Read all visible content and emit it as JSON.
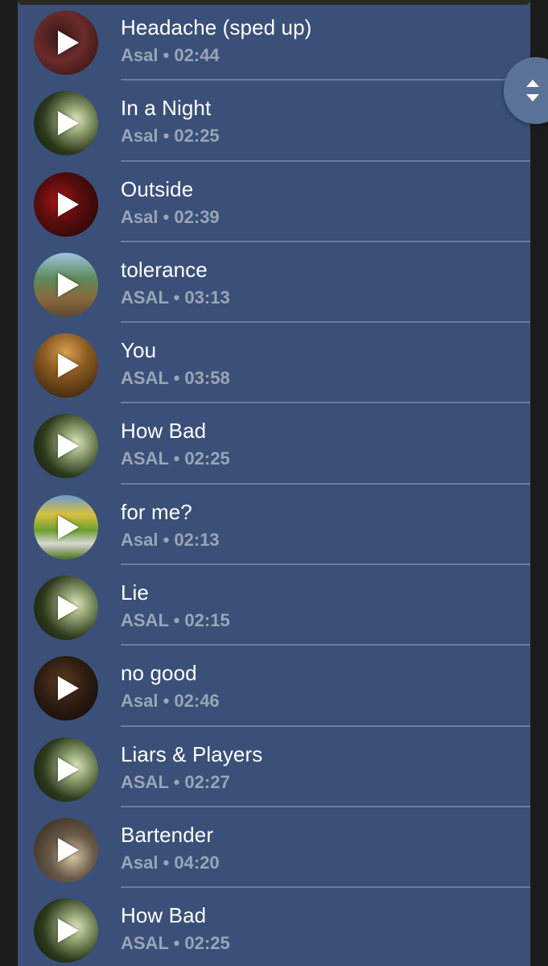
{
  "tracks": [
    {
      "title": "Headache (sped up)",
      "meta": "Asal • 02:44",
      "cover": "red"
    },
    {
      "title": "In a Night",
      "meta": "Asal • 02:25",
      "cover": "green"
    },
    {
      "title": "Outside",
      "meta": "Asal • 02:39",
      "cover": "dark-red"
    },
    {
      "title": "tolerance",
      "meta": "ASAL • 03:13",
      "cover": "beach"
    },
    {
      "title": "You",
      "meta": "ASAL • 03:58",
      "cover": "sunset"
    },
    {
      "title": "How Bad",
      "meta": "ASAL • 02:25",
      "cover": "green"
    },
    {
      "title": "for me?",
      "meta": "Asal • 02:13",
      "cover": "toy"
    },
    {
      "title": "Lie",
      "meta": "ASAL • 02:15",
      "cover": "green"
    },
    {
      "title": "no good",
      "meta": "Asal • 02:46",
      "cover": "room"
    },
    {
      "title": "Liars & Players",
      "meta": "ASAL • 02:27",
      "cover": "green"
    },
    {
      "title": "Bartender",
      "meta": "Asal • 04:20",
      "cover": "bartender"
    },
    {
      "title": "How Bad",
      "meta": "ASAL • 02:25",
      "cover": "green"
    }
  ],
  "icons": {
    "play": "play-icon",
    "scroll": "scroll-updown-icon"
  },
  "colors": {
    "panel": "#3a5078",
    "title": "#ffffff",
    "meta": "#9aa5b7",
    "divider": "#6a7d9f",
    "scroll_handle": "#5a7298"
  }
}
